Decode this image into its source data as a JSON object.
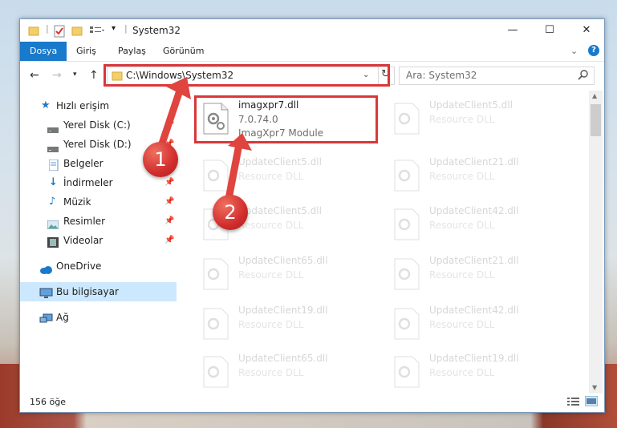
{
  "window": {
    "title": "System32"
  },
  "ribbon": {
    "tabs": [
      "Dosya",
      "Giriş",
      "Paylaş",
      "Görünüm"
    ]
  },
  "address": {
    "path": "C:\\Windows\\System32"
  },
  "search": {
    "placeholder": "Ara: System32"
  },
  "sidebar": {
    "items": [
      {
        "label": "Hızlı erişim",
        "icon": "star-icon"
      },
      {
        "label": "Yerel Disk (C:)",
        "icon": "drive-icon",
        "pinned": true
      },
      {
        "label": "Yerel Disk (D:)",
        "icon": "drive-icon",
        "pinned": true
      },
      {
        "label": "Belgeler",
        "icon": "document-icon",
        "pinned": true
      },
      {
        "label": "İndirmeler",
        "icon": "download-icon",
        "pinned": true
      },
      {
        "label": "Müzik",
        "icon": "music-icon",
        "pinned": true
      },
      {
        "label": "Resimler",
        "icon": "picture-icon",
        "pinned": true
      },
      {
        "label": "Videolar",
        "icon": "video-icon",
        "pinned": true
      },
      {
        "label": "OneDrive",
        "icon": "cloud-icon"
      },
      {
        "label": "Bu bilgisayar",
        "icon": "computer-icon"
      },
      {
        "label": "Ağ",
        "icon": "network-icon"
      }
    ]
  },
  "files": {
    "highlighted": {
      "name": "imagxpr7.dll",
      "version": "7.0.74.0",
      "description": "ImagXpr7 Module"
    },
    "col1": [
      {
        "name": "UpdateClient5.dll",
        "type": "Resource DLL"
      },
      {
        "name": "UpdateClient5.dll",
        "type": "Resource DLL"
      },
      {
        "name": "UpdateClient65.dll",
        "type": "Resource DLL"
      },
      {
        "name": "UpdateClient19.dll",
        "type": "Resource DLL"
      },
      {
        "name": "UpdateClient65.dll",
        "type": "Resource DLL"
      }
    ],
    "col2": [
      {
        "name": "UpdateClient5.dll",
        "type": "Resource DLL"
      },
      {
        "name": "UpdateClient21.dll",
        "type": "Resource DLL"
      },
      {
        "name": "UpdateClient42.dll",
        "type": "Resource DLL"
      },
      {
        "name": "UpdateClient21.dll",
        "type": "Resource DLL"
      },
      {
        "name": "UpdateClient42.dll",
        "type": "Resource DLL"
      },
      {
        "name": "UpdateClient19.dll",
        "type": "Resource DLL"
      }
    ]
  },
  "status": {
    "count": "156 öğe"
  },
  "annotations": {
    "badge1": "1",
    "badge2": "2"
  },
  "colors": {
    "accent": "#1979ca",
    "highlight": "#d9373a",
    "selection": "#cce8ff"
  }
}
